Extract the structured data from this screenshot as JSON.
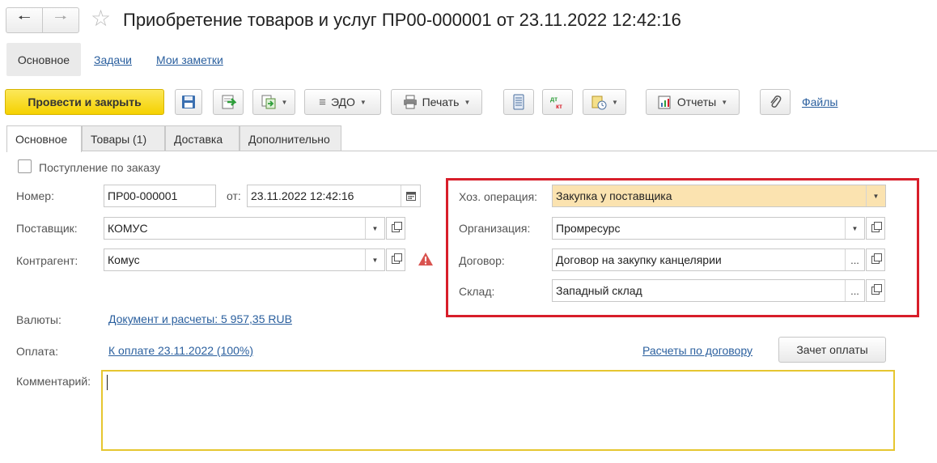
{
  "header": {
    "back_icon": "arrow-left-icon",
    "forward_icon": "arrow-right-icon",
    "favorite_icon": "star-icon",
    "title": "Приобретение товаров и услуг ПР00-000001 от 23.11.2022 12:42:16"
  },
  "section_tabs": {
    "main": "Основное",
    "tasks": "Задачи",
    "notes": "Мои заметки"
  },
  "toolbar": {
    "post_close": "Провести и закрыть",
    "edo": "ЭДО",
    "print": "Печать",
    "reports": "Отчеты",
    "files": "Файлы"
  },
  "tabs": [
    "Основное",
    "Товары (1)",
    "Доставка",
    "Дополнительно"
  ],
  "form": {
    "by_order_label": "Поступление по заказу",
    "number_label": "Номер:",
    "number_value": "ПР00-000001",
    "date_label": "от:",
    "date_value": "23.11.2022 12:42:16",
    "supplier_label": "Поставщик:",
    "supplier_value": "КОМУС",
    "counterparty_label": "Контрагент:",
    "counterparty_value": "Комус",
    "operation_label": "Хоз. операция:",
    "operation_value": "Закупка у поставщика",
    "organization_label": "Организация:",
    "organization_value": "Промресурс",
    "contract_label": "Договор:",
    "contract_value": "Договор на закупку канцелярии",
    "warehouse_label": "Склад:",
    "warehouse_value": "Западный склад",
    "currency_label": "Валюты:",
    "currency_link": "Документ и расчеты: 5 957,35 RUB",
    "payment_label": "Оплата:",
    "payment_link": "К оплате 23.11.2022 (100%)",
    "contract_settlements_link": "Расчеты по договору",
    "offset_button": "Зачет оплаты",
    "comment_label": "Комментарий:",
    "comment_value": ""
  },
  "colors": {
    "primary_button": "#f5d100",
    "highlight_field": "#fbe3b0",
    "red_frame": "#d81e2a",
    "link": "#2a5f9e",
    "comment_border": "#e6c630"
  }
}
